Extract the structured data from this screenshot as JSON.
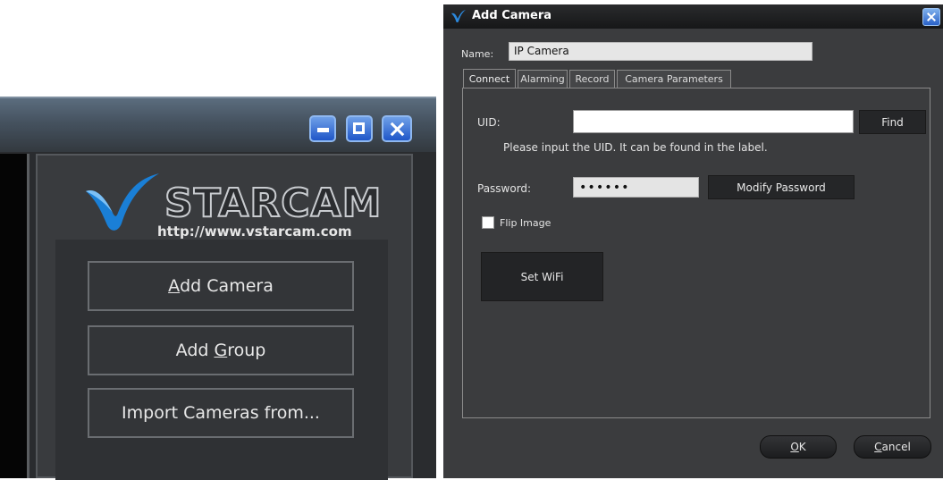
{
  "main_window": {
    "logo": {
      "brand": "STARCAM",
      "url": "http://www.vstarcam.com"
    },
    "window_controls": {
      "minimize": "minimize-icon",
      "maximize": "maximize-icon",
      "close": "close-icon"
    },
    "buttons": {
      "add_camera": {
        "mnemonic": "A",
        "rest": "dd Camera"
      },
      "add_group": {
        "before": "Add ",
        "mnemonic": "G",
        "after": "roup"
      },
      "import_cameras": "Import Cameras from..."
    }
  },
  "dialog": {
    "title": "Add Camera",
    "name_label": "Name:",
    "name_value": "IP Camera",
    "tabs": [
      "Connect",
      "Alarming",
      "Record",
      "Camera Parameters"
    ],
    "active_tab": "Connect",
    "connect": {
      "uid_label": "UID:",
      "uid_value": "",
      "find_button": "Find",
      "uid_hint": "Please input the UID. It can be found in the label.",
      "password_label": "Password:",
      "password_value": "••••••",
      "modify_password_button": "Modify Password",
      "flip_image_label": "Flip Image",
      "flip_image_checked": false,
      "set_wifi_button": "Set WiFi"
    },
    "ok_button": {
      "mnemonic": "O",
      "rest": "K"
    },
    "cancel_button": {
      "mnemonic": "C",
      "rest": "ancel"
    }
  },
  "colors": {
    "accent_blue": "#1f56c8",
    "logo_blue": "#1a7fd6",
    "panel_dark": "#393b3e",
    "dialog_bg": "#3b3c3e"
  }
}
